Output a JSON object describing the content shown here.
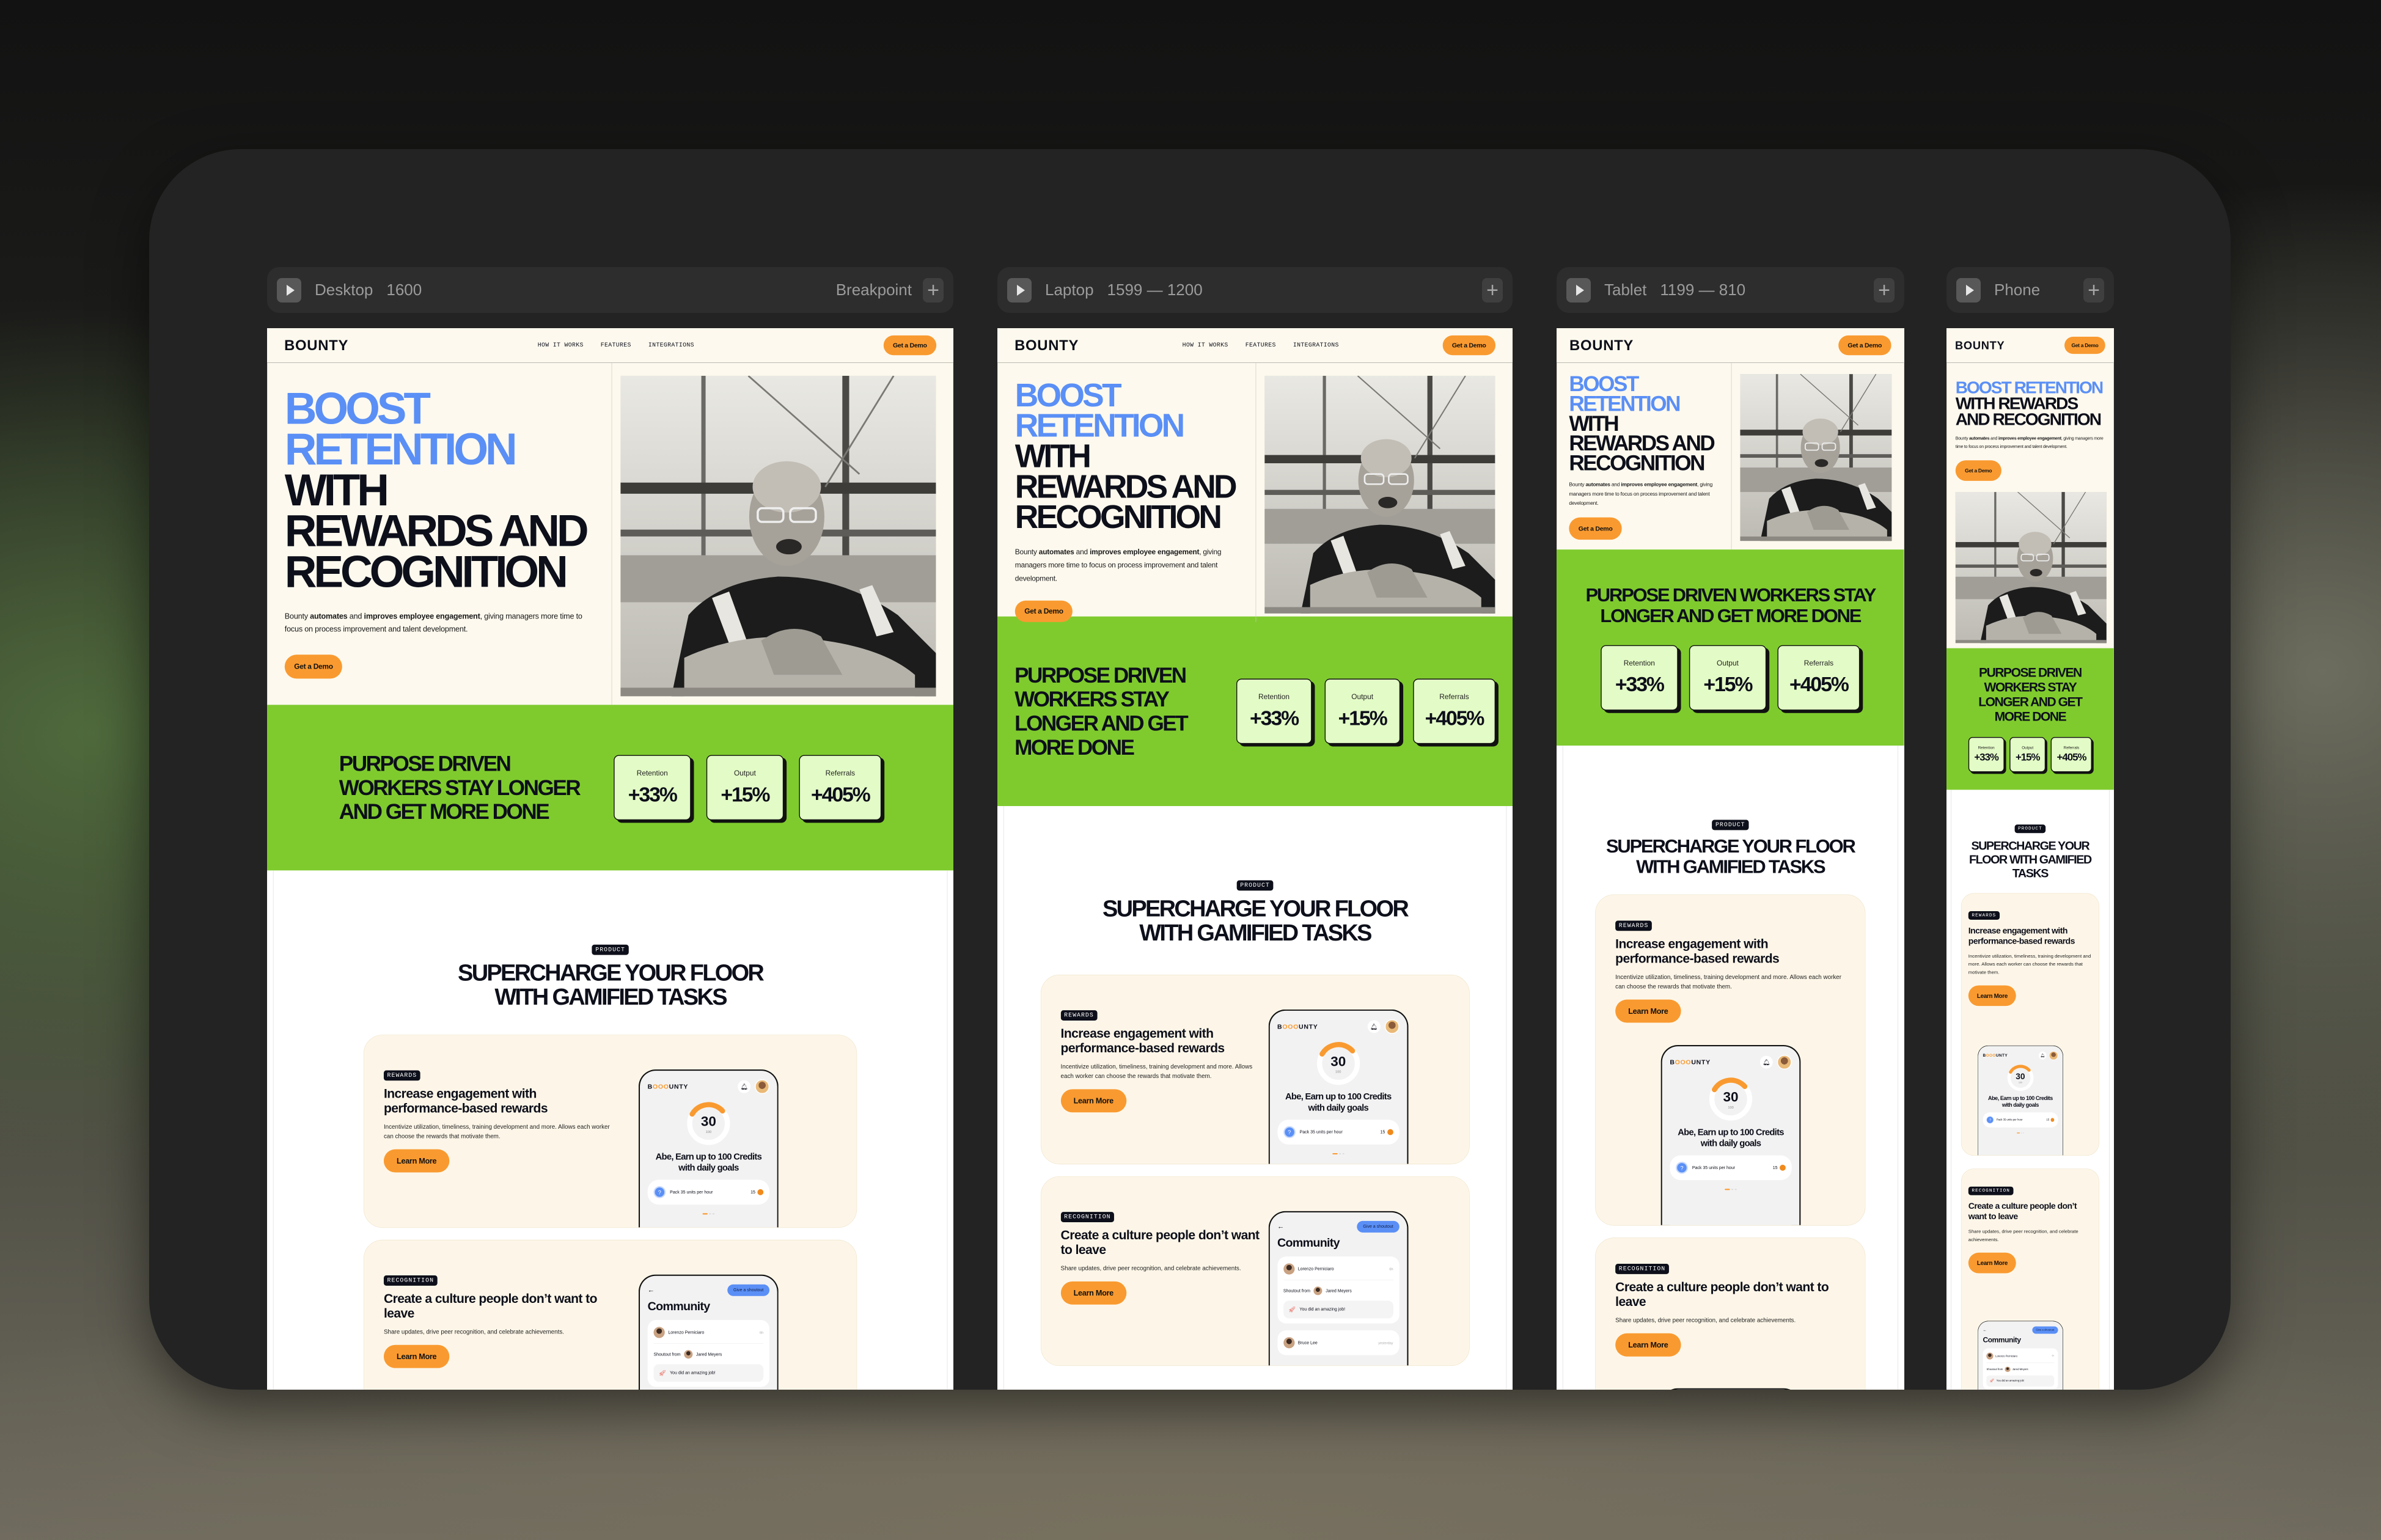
{
  "breakpoints": [
    {
      "name": "Desktop",
      "range": "1600",
      "action": "Breakpoint"
    },
    {
      "name": "Laptop",
      "range": "1599 — 1200"
    },
    {
      "name": "Tablet",
      "range": "1199 — 810"
    },
    {
      "name": "Phone",
      "range": ""
    }
  ],
  "icons": {
    "play": "play-icon",
    "add": "plus-icon",
    "bell": "bell-icon",
    "back": "arrow-left-icon",
    "help": "question-icon",
    "rocket": "rocket-icon"
  },
  "colors": {
    "accent_blue": "#5a8ff6",
    "cta_orange": "#f99a30",
    "band_green": "#7fcb2e",
    "stat_card": "#e3fbc6",
    "cream": "#fdf9ee",
    "ink": "#0d0f1a"
  },
  "nav": {
    "logo": "BOUNTY",
    "links": [
      "HOW IT WORKS",
      "FEATURES",
      "INTEGRATIONS"
    ],
    "cta": "Get a Demo"
  },
  "hero": {
    "headline_accent": "BOOST RETENTION",
    "headline_rest": "WITH REWARDS AND RECOGNITION",
    "body": [
      "Bounty ",
      "automates",
      " and ",
      "improves employee engagement",
      ", giving managers more time to focus on process improvement and talent development."
    ],
    "cta": "Get a Demo"
  },
  "stats": {
    "heading": "PURPOSE DRIVEN WORKERS STAY LONGER AND GET MORE DONE",
    "items": [
      {
        "label": "Retention",
        "value": "+33%"
      },
      {
        "label": "Output",
        "value": "+15%"
      },
      {
        "label": "Referrals",
        "value": "+405%"
      }
    ]
  },
  "product": {
    "tag": "PRODUCT",
    "heading": "SUPERCHARGE YOUR FLOOR WITH GAMIFIED TASKS",
    "features": [
      {
        "tag": "REWARDS",
        "title": "Increase engagement with performance-based rewards",
        "body": "Incentivize utilization, timeliness, training development and more. Allows each worker can choose the rewards that motivate them.",
        "cta": "Learn More"
      },
      {
        "tag": "RECOGNITION",
        "title": "Create a culture people don’t want to leave",
        "body": "Share updates, drive peer recognition, and celebrate achievements.",
        "cta": "Learn More"
      }
    ]
  },
  "rewards_mock": {
    "logo_start": "B",
    "logo_mid": "OOO",
    "logo_end": "UNTY",
    "score": "30",
    "max": "100",
    "progress": 0.3,
    "title": "Abe, Earn up to 100 Credits with daily goals",
    "task": "Pack 35 units per hour",
    "task_points": "15"
  },
  "community_mock": {
    "action": "Give a shoutout",
    "title": "Community",
    "post_author": "Lorenzo Perniciaro",
    "post_time": "6h",
    "shoutout_from": "Shoutout from",
    "shoutout_user": "Jared Meyers",
    "message": "You did an amazing job!",
    "next_author": "Bruce Lee",
    "next_time": "yesterday"
  }
}
